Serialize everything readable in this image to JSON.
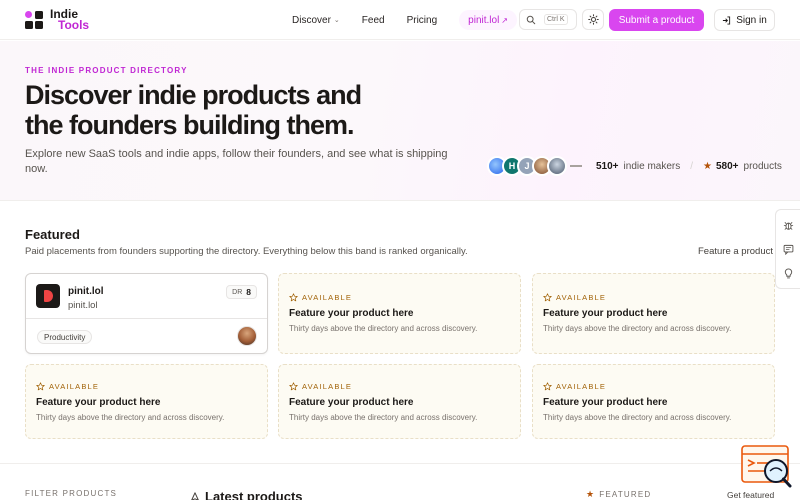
{
  "header": {
    "logo": {
      "line1": "Indie",
      "line2": "Tools"
    },
    "nav": [
      {
        "label": "Discover",
        "has_dropdown": true
      },
      {
        "label": "Feed"
      },
      {
        "label": "Pricing"
      }
    ],
    "promo_link": "pinit.lol",
    "search_shortcut": "Ctrl K",
    "submit_label": "Submit a product",
    "signin_label": "Sign in"
  },
  "hero": {
    "eyebrow": "THE INDIE PRODUCT DIRECTORY",
    "title": "Discover indie products and the founders building them.",
    "subtitle": "Explore new SaaS tools and indie apps, follow their founders, and see what is shipping now.",
    "avatar_initials": [
      "",
      "H",
      "J",
      "",
      ""
    ],
    "makers_count": "510+",
    "makers_label": "indie makers",
    "separator": "/",
    "products_count": "580+",
    "products_label": "products"
  },
  "featured": {
    "title": "Featured",
    "subtitle": "Paid placements from founders supporting the directory. Everything below this band is ranked organically.",
    "link_label": "Feature a product",
    "product": {
      "name": "pinit.lol",
      "domain": "pinit.lol",
      "dr_label": "DR",
      "dr_value": "8",
      "tag": "Productivity"
    },
    "slots": [
      {
        "badge": "AVAILABLE",
        "title": "Feature your product here",
        "desc": "Thirty days above the directory and across discovery."
      },
      {
        "badge": "AVAILABLE",
        "title": "Feature your product here",
        "desc": "Thirty days above the directory and across discovery."
      },
      {
        "badge": "AVAILABLE",
        "title": "Feature your product here",
        "desc": "Thirty days above the directory and across discovery."
      },
      {
        "badge": "AVAILABLE",
        "title": "Feature your product here",
        "desc": "Thirty days above the directory and across discovery."
      },
      {
        "badge": "AVAILABLE",
        "title": "Feature your product here",
        "desc": "Thirty days above the directory and across discovery."
      }
    ]
  },
  "bottom": {
    "filter_label": "FILTER PRODUCTS",
    "latest_title": "Latest products",
    "featured_label": "FEATURED",
    "get_featured": "Get featured"
  },
  "colors": {
    "accent": "#d946ef",
    "accent_text": "#c026d3",
    "slot_bg": "#fdfbf3",
    "available": "#a16207"
  },
  "icons": {
    "rail": [
      "bug-icon",
      "chat-icon",
      "lightbulb-icon"
    ]
  }
}
